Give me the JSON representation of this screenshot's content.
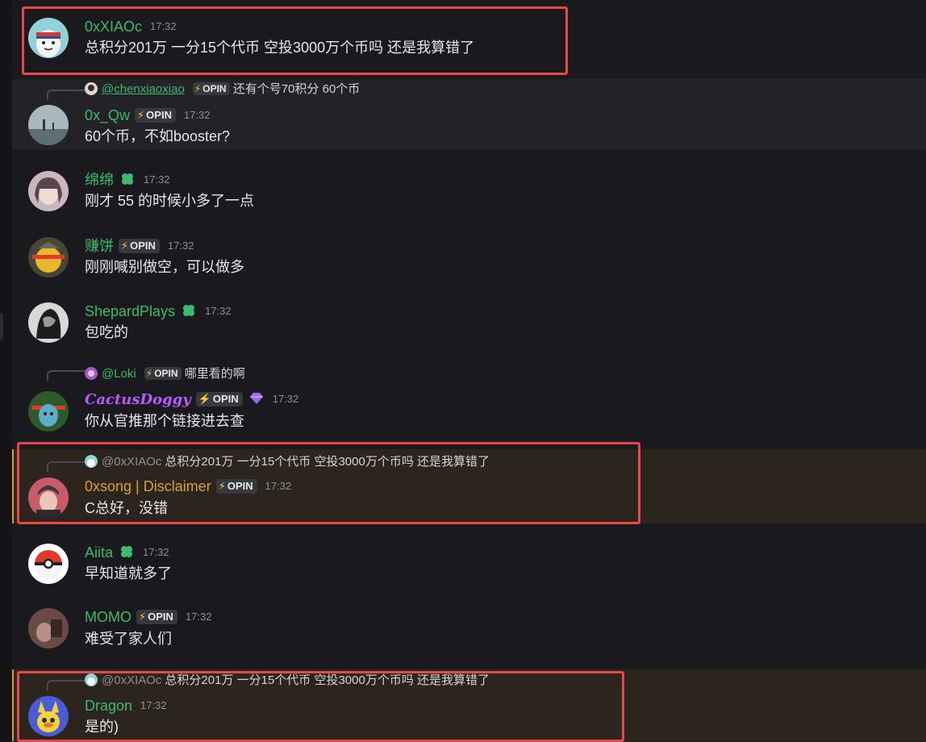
{
  "messages": [
    {
      "user": "0xXIAOc",
      "time": "17:32",
      "text": "总积分201万 一分15个代币 空投3000万个币吗  还是我算错了"
    },
    {
      "reply": {
        "user": "@chenxiaoxiao",
        "badge": "OPIN",
        "text": "还有个号70积分 60个币"
      },
      "user": "0x_Qw",
      "badge": "OPIN",
      "time": "17:32",
      "text": "60个币，不如booster?"
    },
    {
      "user": "绵绵",
      "time": "17:32",
      "text": "刚才 55 的时候小多了一点"
    },
    {
      "user": "赚饼",
      "badge": "OPIN",
      "time": "17:32",
      "text": "刚刚喊别做空，可以做多"
    },
    {
      "user": "ShepardPlays",
      "time": "17:32",
      "text": "包吃的"
    },
    {
      "reply": {
        "user": "@Loki",
        "badge": "OPIN",
        "text": "哪里看的啊"
      },
      "user": "CactusDoggy",
      "badge": "OPIN",
      "time": "17:32",
      "text": "你从官推那个链接进去查"
    },
    {
      "reply": {
        "user": "@0xXIAOc",
        "text": "总积分201万 一分15个代币 空投3000万个币吗  还是我算错了"
      },
      "user": "0xsong | Disclaimer",
      "badge": "OPIN",
      "time": "17:32",
      "text": "C总好，没错"
    },
    {
      "user": "Aiita",
      "time": "17:32",
      "text": "早知道就多了"
    },
    {
      "user": "MOMO",
      "badge": "OPIN",
      "time": "17:32",
      "text": "难受了家人们"
    },
    {
      "reply": {
        "user": "@0xXIAOc",
        "text": "总积分201万 一分15个代币 空投3000万个币吗  还是我算错了"
      },
      "user": "Dragon",
      "time": "17:32",
      "text": "是的)"
    }
  ],
  "colors": {
    "background": "#1a1a1e",
    "username_green": "#3cba6f",
    "username_gold": "#d9a03a",
    "username_purple": "#b85cff",
    "highlight_box": "#e5484d",
    "mention_bg": "#2c251d"
  },
  "icons": {
    "role_icon": "clover-icon",
    "badge_icon": "lightning-bolt-icon",
    "nitro": "purple-gem-icon"
  }
}
